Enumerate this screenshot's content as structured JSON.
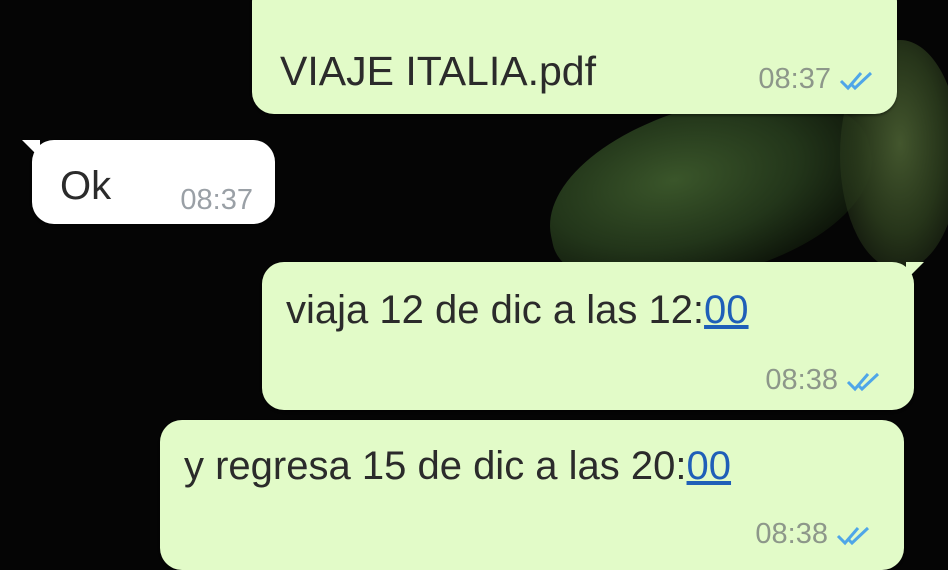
{
  "chat": {
    "messages": [
      {
        "direction": "outgoing",
        "type": "document",
        "text": "VIAJE ITALIA.pdf",
        "time": "08:37",
        "status": "read"
      },
      {
        "direction": "incoming",
        "type": "text",
        "text": "Ok",
        "time": "08:37"
      },
      {
        "direction": "outgoing",
        "type": "text",
        "text_before_link": "viaja 12 de dic a las 12:",
        "link_text": "00",
        "time": "08:38",
        "status": "read"
      },
      {
        "direction": "outgoing",
        "type": "text",
        "text_before_link": "y regresa 15 de dic a las 20:",
        "link_text": "00",
        "time": "08:38",
        "status": "read"
      }
    ]
  },
  "icons": {
    "read_receipt": "double-check-icon"
  },
  "colors": {
    "outgoing_bubble": "#e2fbc8",
    "incoming_bubble": "#ffffff",
    "read_tick": "#4fa6e8",
    "link": "#1f5fb8",
    "background": "#050505"
  }
}
